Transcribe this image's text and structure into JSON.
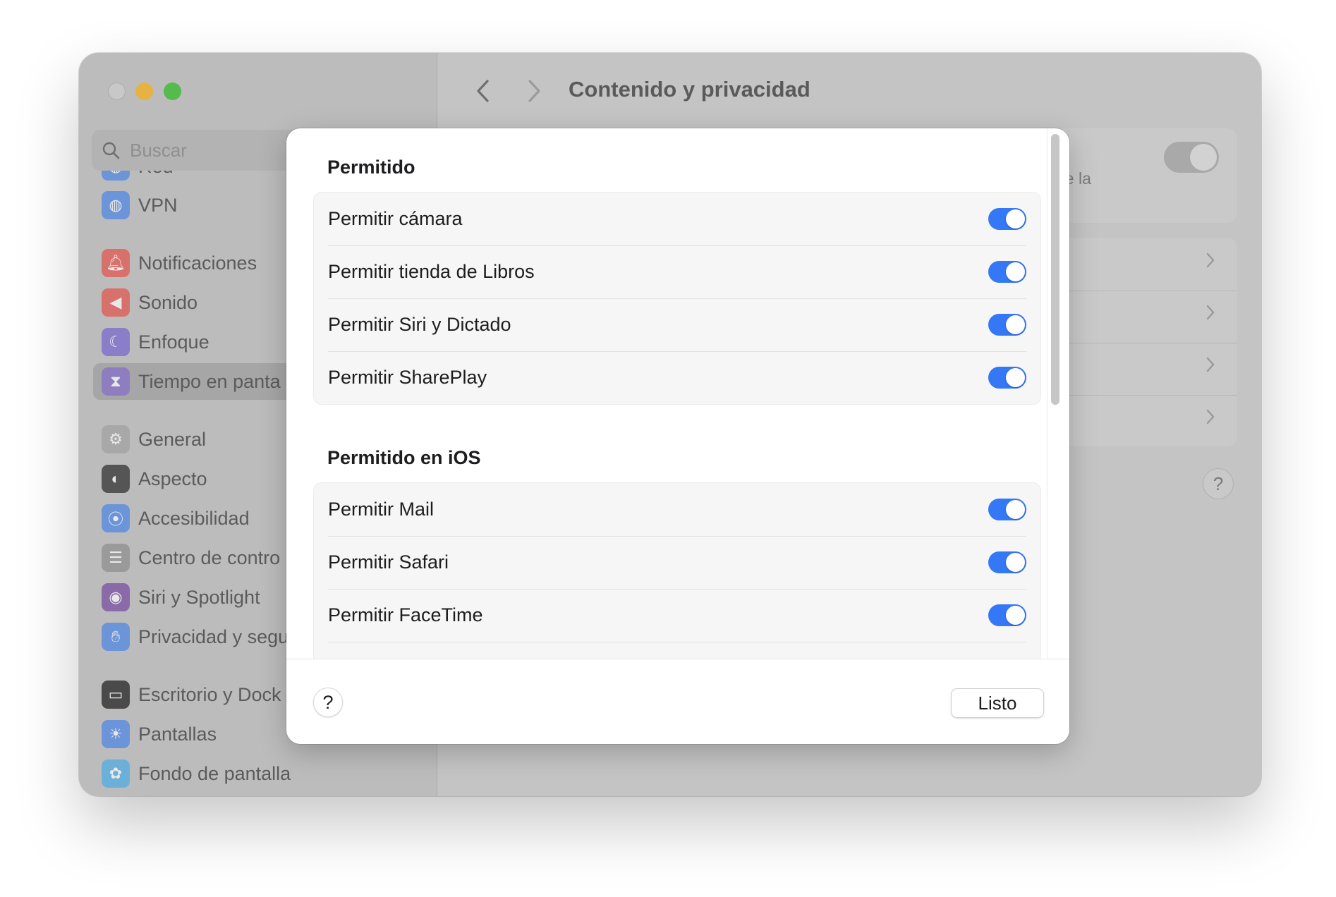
{
  "window": {
    "title": "Contenido y privacidad",
    "search_placeholder": "Buscar"
  },
  "sidebar": {
    "items": [
      {
        "label": "Red",
        "icon": "globe-icon",
        "color": "#4a7fd6"
      },
      {
        "label": "VPN",
        "icon": "globe-icon",
        "color": "#4a7fd6"
      },
      {
        "label": "Notificaciones",
        "icon": "bell-icon",
        "color": "#e0504a"
      },
      {
        "label": "Sonido",
        "icon": "speaker-icon",
        "color": "#e0504a"
      },
      {
        "label": "Enfoque",
        "icon": "moon-icon",
        "color": "#6a5acd"
      },
      {
        "label": "Tiempo en panta",
        "icon": "hourglass-icon",
        "color": "#7a5ac8",
        "selected": true
      },
      {
        "label": "General",
        "icon": "gear-icon",
        "color": "#9a9a9a"
      },
      {
        "label": "Aspecto",
        "icon": "appearance-icon",
        "color": "#2a2a2a"
      },
      {
        "label": "Accesibilidad",
        "icon": "accessibility-icon",
        "color": "#3a7ad8"
      },
      {
        "label": "Centro de contro",
        "icon": "control-center-icon",
        "color": "#8a8a8a"
      },
      {
        "label": "Siri y Spotlight",
        "icon": "siri-icon",
        "color": "#8a4ab8"
      },
      {
        "label": "Privacidad y segu",
        "icon": "hand-icon",
        "color": "#3a7ad8"
      },
      {
        "label": "Escritorio y Dock",
        "icon": "dock-icon",
        "color": "#2a2a2a"
      },
      {
        "label": "Pantallas",
        "icon": "sun-icon",
        "color": "#3a7ad8"
      },
      {
        "label": "Fondo de pantalla",
        "icon": "flower-icon",
        "color": "#3aa0d8"
      }
    ]
  },
  "background": {
    "partial_text": "de la"
  },
  "modal": {
    "section1_title": "Permitido",
    "section1_rows": [
      {
        "label": "Permitir cámara",
        "on": true
      },
      {
        "label": "Permitir tienda de Libros",
        "on": true
      },
      {
        "label": "Permitir Siri y Dictado",
        "on": true
      },
      {
        "label": "Permitir SharePlay",
        "on": true
      }
    ],
    "section2_title": "Permitido en iOS",
    "section2_rows": [
      {
        "label": "Permitir Mail",
        "on": true
      },
      {
        "label": "Permitir Safari",
        "on": true
      },
      {
        "label": "Permitir FaceTime",
        "on": true
      }
    ],
    "help_label": "?",
    "done_label": "Listo"
  },
  "colors": {
    "accent": "#3478f6"
  }
}
